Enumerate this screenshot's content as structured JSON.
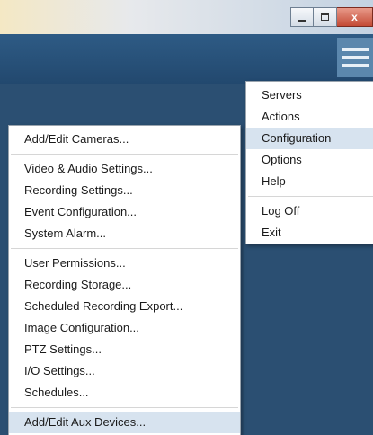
{
  "window": {
    "minimize_glyph": "–",
    "maximize_glyph": "▢",
    "close_glyph": "x"
  },
  "main_menu": {
    "items": [
      {
        "label": "Servers",
        "has_submenu": true
      },
      {
        "label": "Actions",
        "has_submenu": true
      },
      {
        "label": "Configuration",
        "has_submenu": true,
        "highlighted": true
      },
      {
        "label": "Options",
        "has_submenu": true
      },
      {
        "label": "Help",
        "has_submenu": true
      },
      {
        "label": "Log Off",
        "has_submenu": false
      },
      {
        "label": "Exit",
        "has_submenu": false
      }
    ]
  },
  "config_menu": {
    "groups": [
      [
        "Add/Edit Cameras..."
      ],
      [
        "Video & Audio Settings...",
        "Recording Settings...",
        "Event Configuration...",
        "System Alarm..."
      ],
      [
        "User Permissions...",
        "Recording Storage...",
        "Scheduled Recording Export...",
        "Image Configuration...",
        "PTZ Settings...",
        "I/O Settings...",
        "Schedules..."
      ],
      [
        "Add/Edit Aux Devices..."
      ]
    ],
    "highlighted_item": "Add/Edit Aux Devices..."
  },
  "colors": {
    "app_bar": "#22486e",
    "highlight": "#d7e3ef",
    "hamburger": "#5b87ad"
  }
}
